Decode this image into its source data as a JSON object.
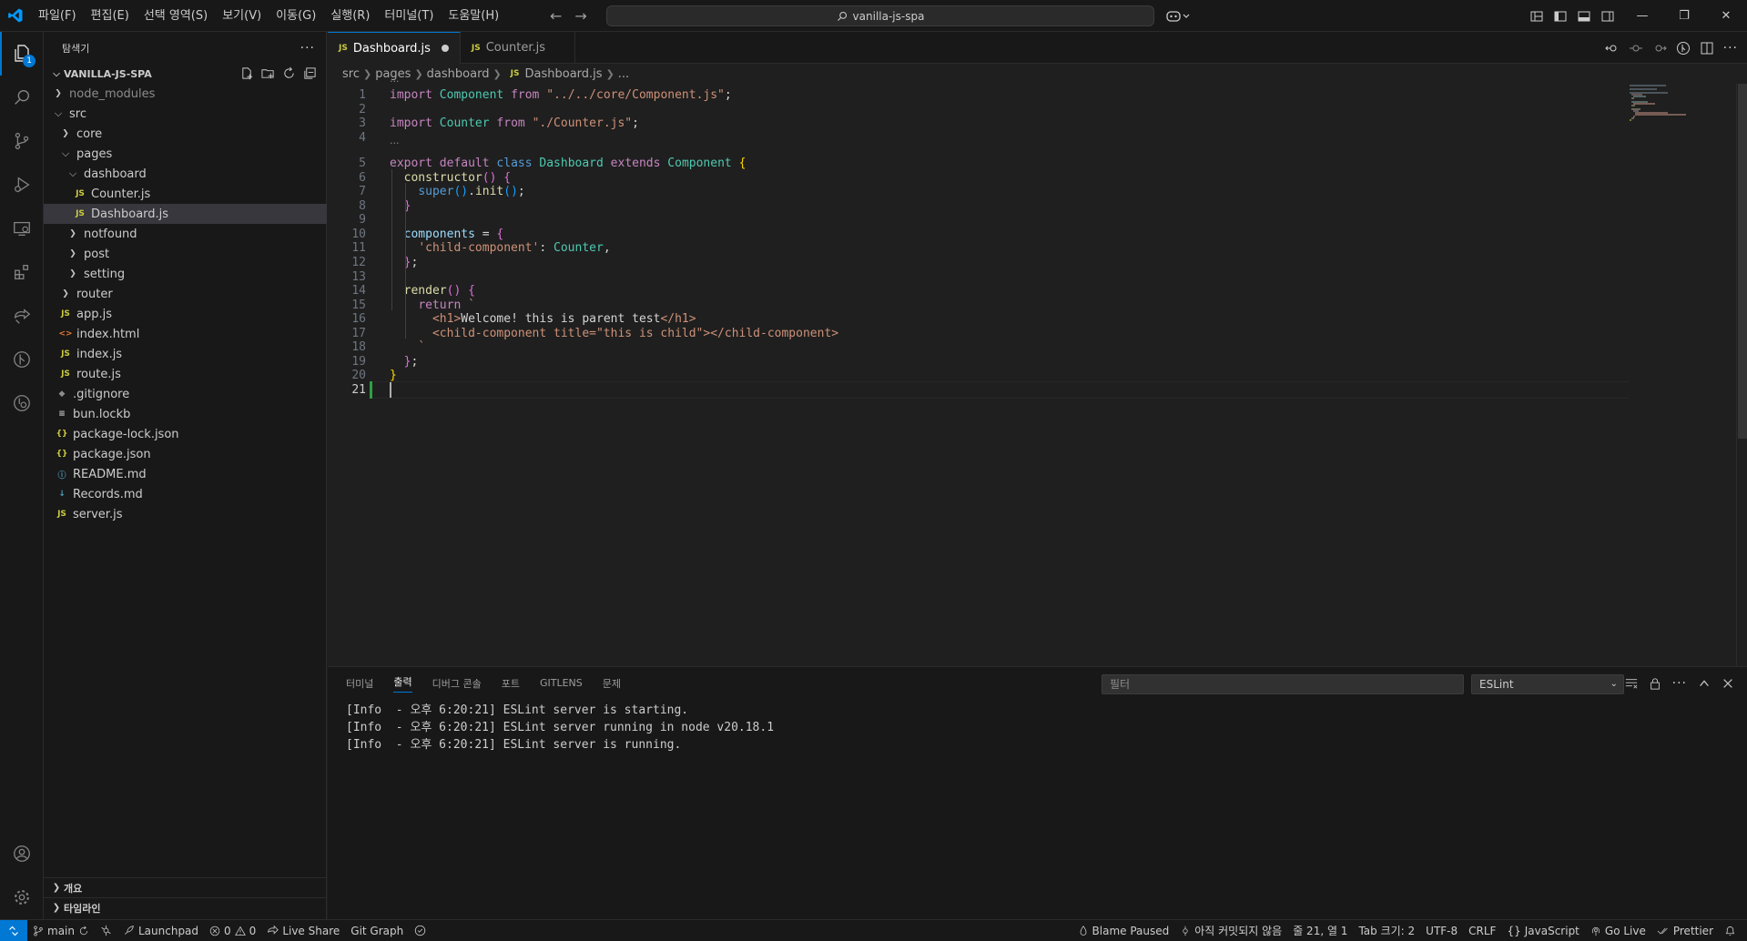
{
  "titlebar": {
    "menu": [
      "파일(F)",
      "편집(E)",
      "선택 영역(S)",
      "보기(V)",
      "이동(G)",
      "실행(R)",
      "터미널(T)",
      "도움말(H)"
    ],
    "search_text": "vanilla-js-spa"
  },
  "activity": {
    "explorer_badge": "1"
  },
  "sidebar": {
    "title": "탐색기",
    "project": "VANILLA-JS-SPA",
    "tree": [
      {
        "label": "node_modules",
        "depth": 0,
        "type": "folder",
        "open": false,
        "dim": true
      },
      {
        "label": "src",
        "depth": 0,
        "type": "folder",
        "open": true
      },
      {
        "label": "core",
        "depth": 1,
        "type": "folder",
        "open": false
      },
      {
        "label": "pages",
        "depth": 1,
        "type": "folder",
        "open": true
      },
      {
        "label": "dashboard",
        "depth": 2,
        "type": "folder",
        "open": true
      },
      {
        "label": "Counter.js",
        "depth": 3,
        "type": "js"
      },
      {
        "label": "Dashboard.js",
        "depth": 3,
        "type": "js",
        "selected": true
      },
      {
        "label": "notfound",
        "depth": 2,
        "type": "folder",
        "open": false
      },
      {
        "label": "post",
        "depth": 2,
        "type": "folder",
        "open": false
      },
      {
        "label": "setting",
        "depth": 2,
        "type": "folder",
        "open": false
      },
      {
        "label": "router",
        "depth": 1,
        "type": "folder",
        "open": false
      },
      {
        "label": "app.js",
        "depth": 1,
        "type": "js"
      },
      {
        "label": "index.html",
        "depth": 1,
        "type": "html"
      },
      {
        "label": "index.js",
        "depth": 1,
        "type": "js"
      },
      {
        "label": "route.js",
        "depth": 1,
        "type": "js"
      },
      {
        "label": ".gitignore",
        "depth": 0,
        "type": "git"
      },
      {
        "label": "bun.lockb",
        "depth": 0,
        "type": "lock"
      },
      {
        "label": "package-lock.json",
        "depth": 0,
        "type": "json"
      },
      {
        "label": "package.json",
        "depth": 0,
        "type": "json"
      },
      {
        "label": "README.md",
        "depth": 0,
        "type": "info"
      },
      {
        "label": "Records.md",
        "depth": 0,
        "type": "md"
      },
      {
        "label": "server.js",
        "depth": 0,
        "type": "js"
      }
    ],
    "outline": "개요",
    "timeline": "타임라인"
  },
  "tabs": [
    {
      "label": "Dashboard.js",
      "active": true,
      "dirty": true
    },
    {
      "label": "Counter.js",
      "active": false,
      "dirty": false
    }
  ],
  "breadcrumb": [
    "src",
    "pages",
    "dashboard",
    "Dashboard.js",
    "..."
  ],
  "code": {
    "codelens": "...",
    "lines": [
      "import Component from \"../../core/Component.js\";",
      "",
      "import Counter from \"./Counter.js\";",
      "",
      "export default class Dashboard extends Component {",
      "  constructor() {",
      "    super().init();",
      "  }",
      "",
      "  components = {",
      "    'child-component': Counter,",
      "  };",
      "",
      "  render() {",
      "    return `",
      "      <h1>Welcome! this is parent test</h1>",
      "      <child-component title=\"this is child\"></child-component>",
      "    `",
      "  };",
      "}",
      ""
    ],
    "current_line": 21
  },
  "panel": {
    "tabs": [
      "터미널",
      "출력",
      "디버그 콘솔",
      "포트",
      "GITLENS",
      "문제"
    ],
    "active_tab": 1,
    "filter_placeholder": "필터",
    "channel": "ESLint",
    "output": [
      "[Info  - 오후 6:20:21] ESLint server is starting.",
      "[Info  - 오후 6:20:21] ESLint server running in node v20.18.1",
      "[Info  - 오후 6:20:21] ESLint server is running."
    ]
  },
  "statusbar": {
    "branch": "main",
    "launchpad": "Launchpad",
    "errors": "0",
    "warnings": "0",
    "live_share": "Live Share",
    "git_graph": "Git Graph",
    "blame": "Blame Paused",
    "commit": "아직 커밋되지 않음",
    "position": "줄 21, 열 1",
    "tab_size": "Tab 크기: 2",
    "encoding": "UTF-8",
    "eol": "CRLF",
    "language": "JavaScript",
    "go_live": "Go Live",
    "prettier": "Prettier"
  },
  "colors": {
    "accent": "#0078d4",
    "modified": "#2ea043"
  }
}
